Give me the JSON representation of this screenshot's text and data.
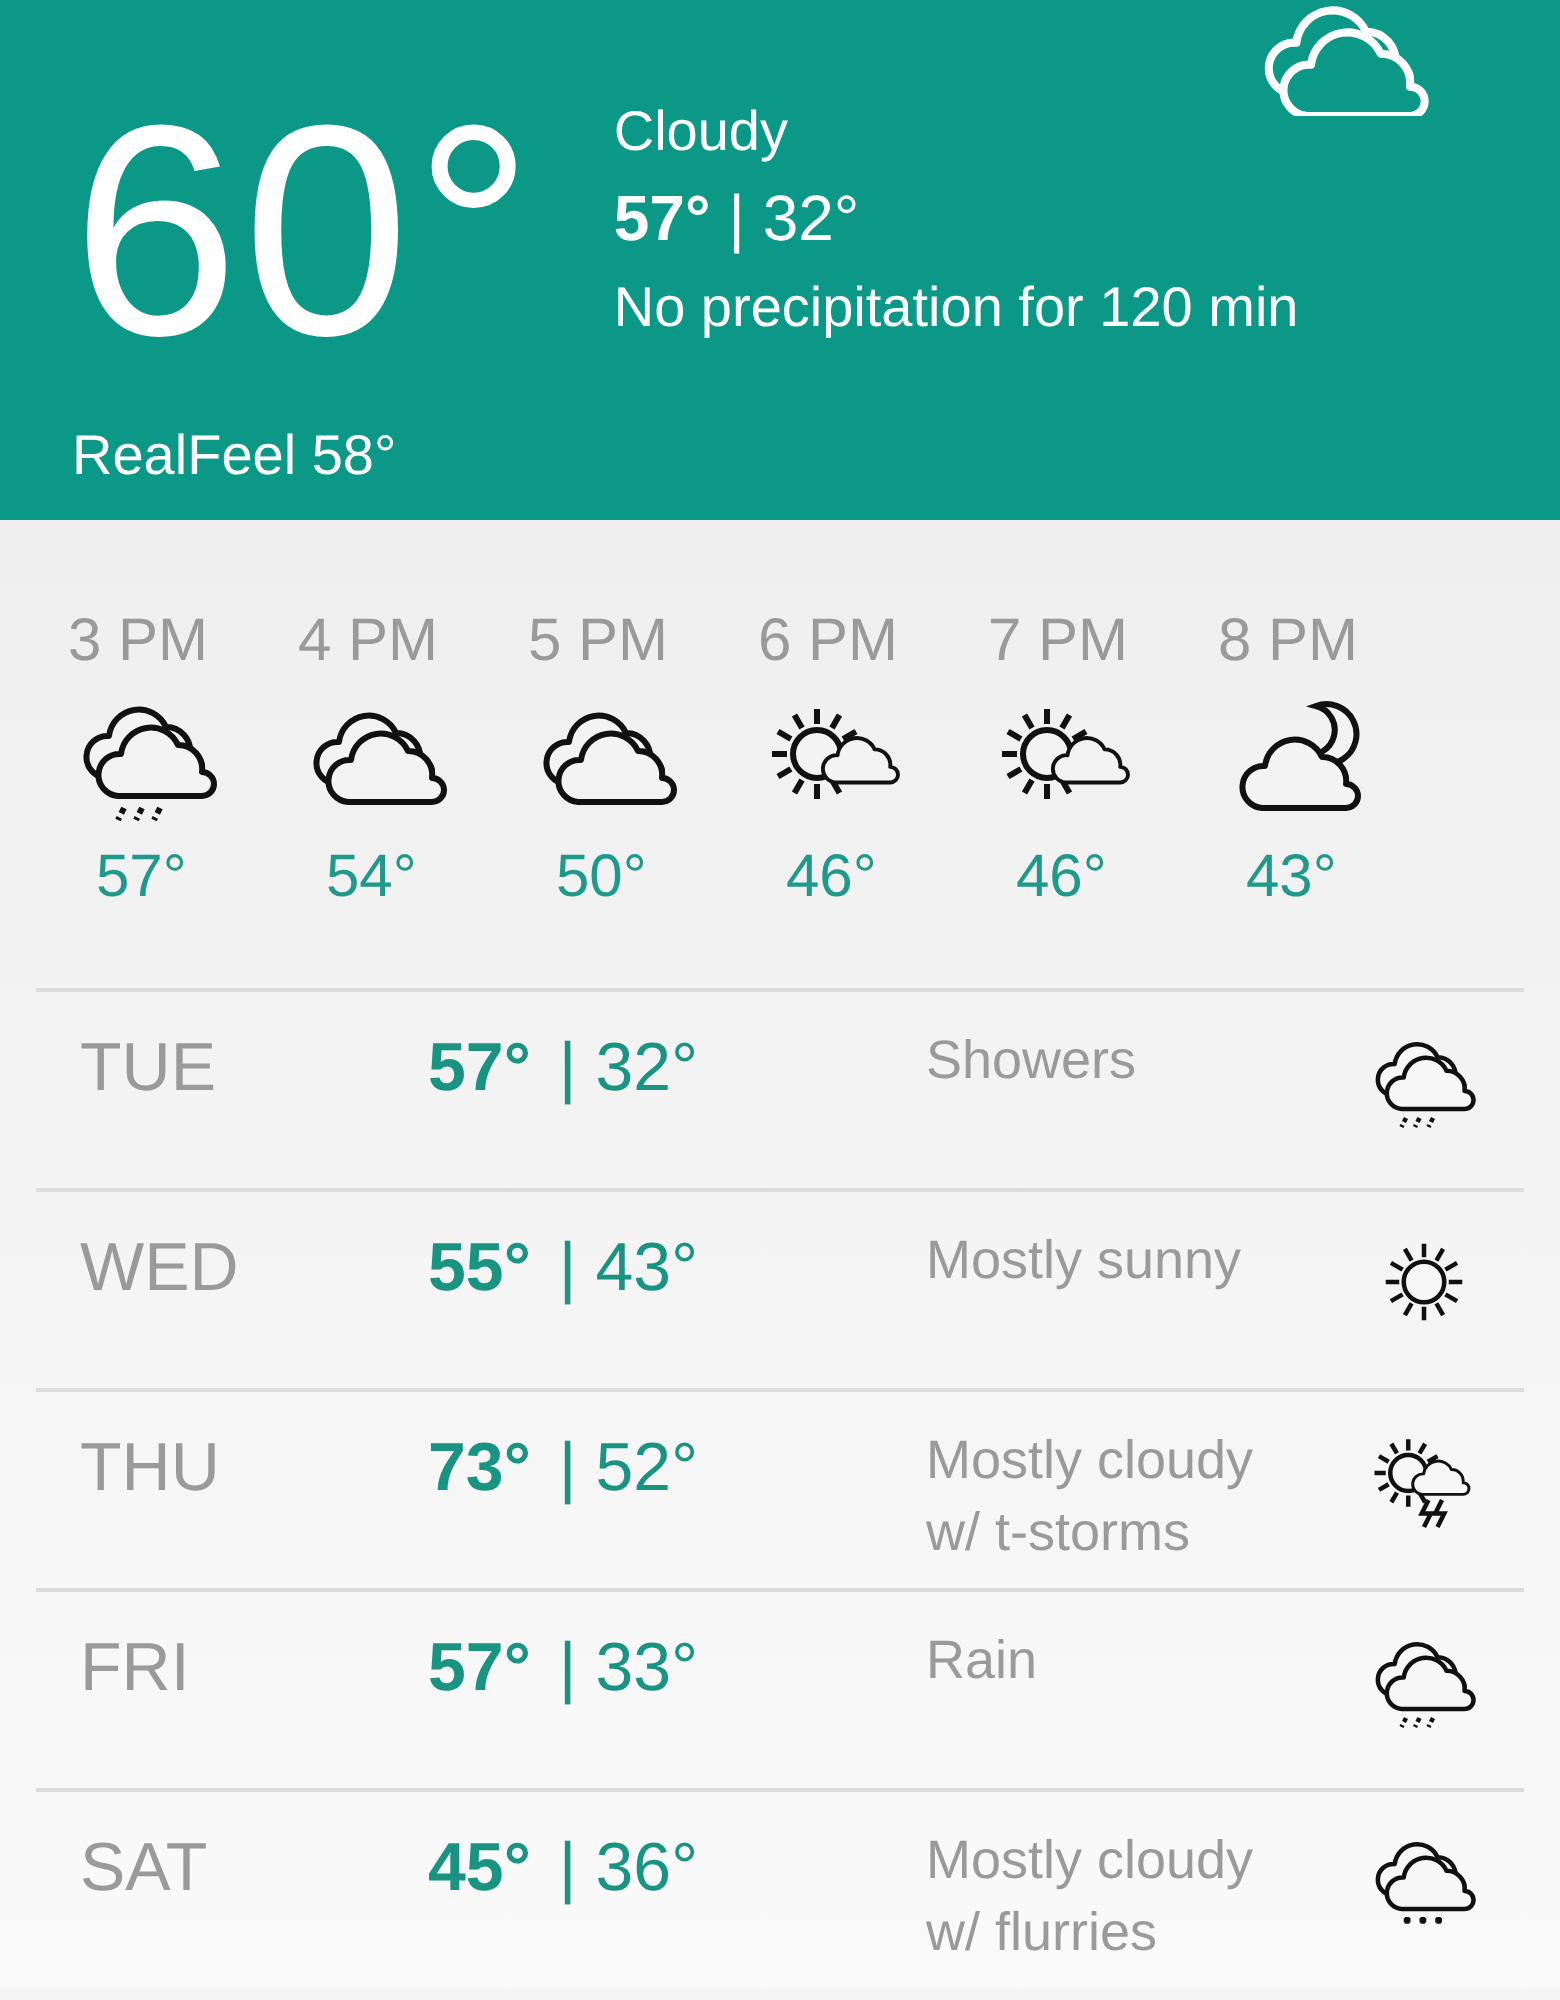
{
  "current": {
    "kind": "cloudy",
    "temperature": "60°",
    "condition": "Cloudy",
    "high_low": "**57°** | 32°",
    "precipitation": "No precipitation for 120 min",
    "realfeel": "RealFeel 58°"
  },
  "hourly": [
    {
      "time": "3 PM",
      "kind": "rain",
      "temp": "57°"
    },
    {
      "time": "4 PM",
      "kind": "cloudy",
      "temp": "54°"
    },
    {
      "time": "5 PM",
      "kind": "cloudy",
      "temp": "50°"
    },
    {
      "time": "6 PM",
      "kind": "partly-sunny",
      "temp": "46°"
    },
    {
      "time": "7 PM",
      "kind": "partly-sunny",
      "temp": "46°"
    },
    {
      "time": "8 PM",
      "kind": "night-cloudy",
      "temp": "43°"
    }
  ],
  "daily": [
    {
      "day": "TUE",
      "high": "57°",
      "low": "| 32°",
      "condition": "Showers",
      "kind": "rain"
    },
    {
      "day": "WED",
      "high": "55°",
      "low": "| 43°",
      "condition": "Mostly sunny",
      "kind": "sunny"
    },
    {
      "day": "THU",
      "high": "73°",
      "low": "| 52°",
      "condition": "Mostly cloudy w/ t-storms",
      "kind": "tstorm"
    },
    {
      "day": "FRI",
      "high": "57°",
      "low": "| 33°",
      "condition": "Rain",
      "kind": "rain"
    },
    {
      "day": "SAT",
      "high": "45°",
      "low": "| 36°",
      "condition": "Mostly cloudy w/ flurries",
      "kind": "snow"
    }
  ]
}
